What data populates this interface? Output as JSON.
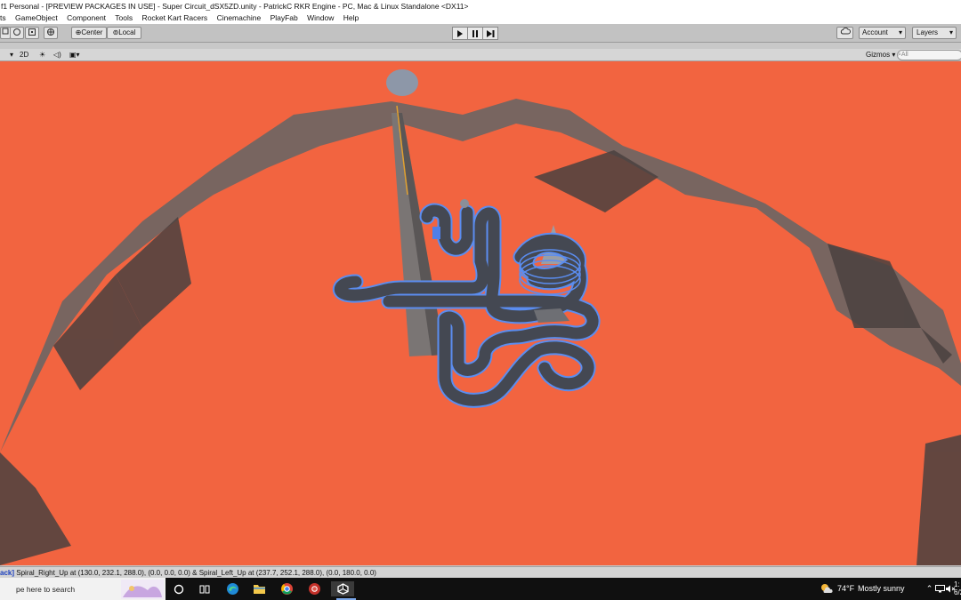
{
  "window": {
    "title": "f1 Personal - [PREVIEW PACKAGES IN USE] - Super Circuit_dSX5ZD.unity - PatrickC RKR Engine - PC, Mac & Linux Standalone <DX11>"
  },
  "menu": [
    "ts",
    "GameObject",
    "Component",
    "Tools",
    "Rocket Kart Racers",
    "Cinemachine",
    "PlayFab",
    "Window",
    "Help"
  ],
  "toolbar": {
    "pivot_label": "Center",
    "space_label": "Local",
    "account_label": "Account",
    "layers_label": "Layers"
  },
  "scene_header": {
    "mode_2d": "2D",
    "gizmos_label": "Gizmos",
    "search_placeholder": "All"
  },
  "status": {
    "prefix": "ack]",
    "message": "Spiral_Right_Up at (130.0, 232.1, 288.0), (0.0, 0.0, 0.0) & Spiral_Left_Up at (237.7, 252.1, 288.0), (0.0, 180.0, 0.0)"
  },
  "taskbar": {
    "search_placeholder": "pe here to search",
    "weather_temp": "74°F",
    "weather_desc": "Mostly sunny",
    "clock_time": "1:",
    "clock_date": "6/2"
  },
  "colors": {
    "scene_bg": "#f26440",
    "track_outline": "#5b8df0",
    "track_fill": "#4a4e58"
  }
}
